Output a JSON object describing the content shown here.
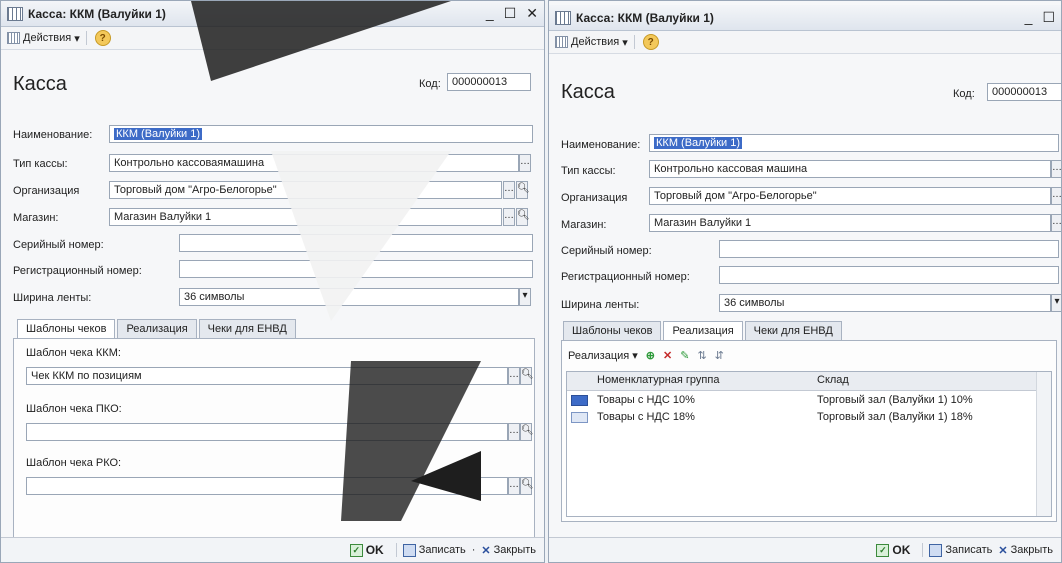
{
  "left": {
    "title": "Касса: ККМ (Валуйки 1)",
    "actions": "Действия",
    "heading": "Касса",
    "code_label": "Код:",
    "code_value": "000000013",
    "name_label": "Наименование:",
    "name_value": "ККМ (Валуйки 1)",
    "type_label": "Тип кассы:",
    "type_value": "Контрольно кассоваямашина",
    "org_label": "Организация",
    "org_value": "Торговый дом \"Агро-Белогорье\"",
    "shop_label": "Магазин:",
    "shop_value": "Магазин Валуйки 1",
    "serial_label": "Серийный номер:",
    "reg_label": "Регистрационный номер:",
    "width_label": "Ширина ленты:",
    "width_value": "36 символы",
    "tabs": [
      "Шаблоны чеков",
      "Реализация",
      "Чеки для ЕНВД"
    ],
    "tpl_kkm_label": "Шаблон чека ККМ:",
    "tpl_kkm_value": "Чек ККМ по позициям",
    "tpl_pko_label": "Шаблон чека ПКО:",
    "tpl_rko_label": "Шаблон чека РКО:",
    "ok": "OK",
    "save": "Записать",
    "close": "Закрыть"
  },
  "right": {
    "title": "Касса: ККМ (Валуйки 1)",
    "actions": "Действия",
    "heading": "Касса",
    "code_label": "Код:",
    "code_value": "000000013",
    "name_label": "Наименование:",
    "name_value": "ККМ (Валуйки 1)",
    "type_label": "Тип кассы:",
    "type_value": "Контрольно кассовая машина",
    "org_label": "Организация",
    "org_value": "Торговый дом \"Агро-Белогорье\"",
    "shop_label": "Магазин:",
    "shop_value": "Магазин Валуйки 1",
    "serial_label": "Серийный номер:",
    "reg_label": "Регистрационный номер:",
    "width_label": "Ширина ленты:",
    "width_value": "36 символы",
    "tabs": [
      "Шаблоны чеков",
      "Реализация",
      "Чеки для ЕНВД"
    ],
    "grid_toolbar_label": "Реализация",
    "col1": "Номенклатурная группа",
    "col2": "Склад",
    "rows": [
      {
        "group": "Товары с НДС 10%",
        "store": "Торговый зал (Валуйки 1) 10%"
      },
      {
        "group": "Товары с НДС 18%",
        "store": "Торговый зал (Валуйки 1) 18%"
      }
    ],
    "ok": "OK",
    "save": "Записать",
    "close": "Закрыть"
  }
}
